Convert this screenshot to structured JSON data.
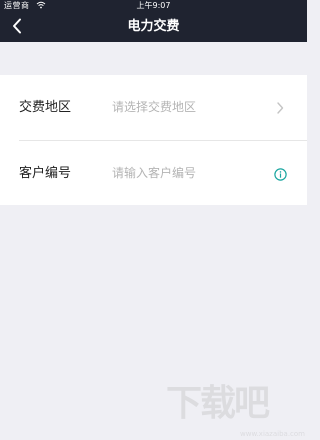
{
  "status_bar": {
    "carrier": "运营商",
    "wifi_icon": "wifi-icon",
    "time": "上午9:07"
  },
  "nav": {
    "back_icon": "chevron-left-icon",
    "title": "电力交费"
  },
  "form": {
    "rows": [
      {
        "label": "交费地区",
        "placeholder": "请选择交费地区",
        "trailing_icon": "chevron-right-icon"
      },
      {
        "label": "客户编号",
        "placeholder": "请输入客户编号",
        "trailing_icon": "info-circle-icon"
      }
    ]
  },
  "colors": {
    "nav_background": "#1f2330",
    "page_background": "#efeff4",
    "info_icon": "#1aa6a0"
  },
  "watermark": {
    "text": "下载吧",
    "url": "www.xiazaiba.com"
  }
}
